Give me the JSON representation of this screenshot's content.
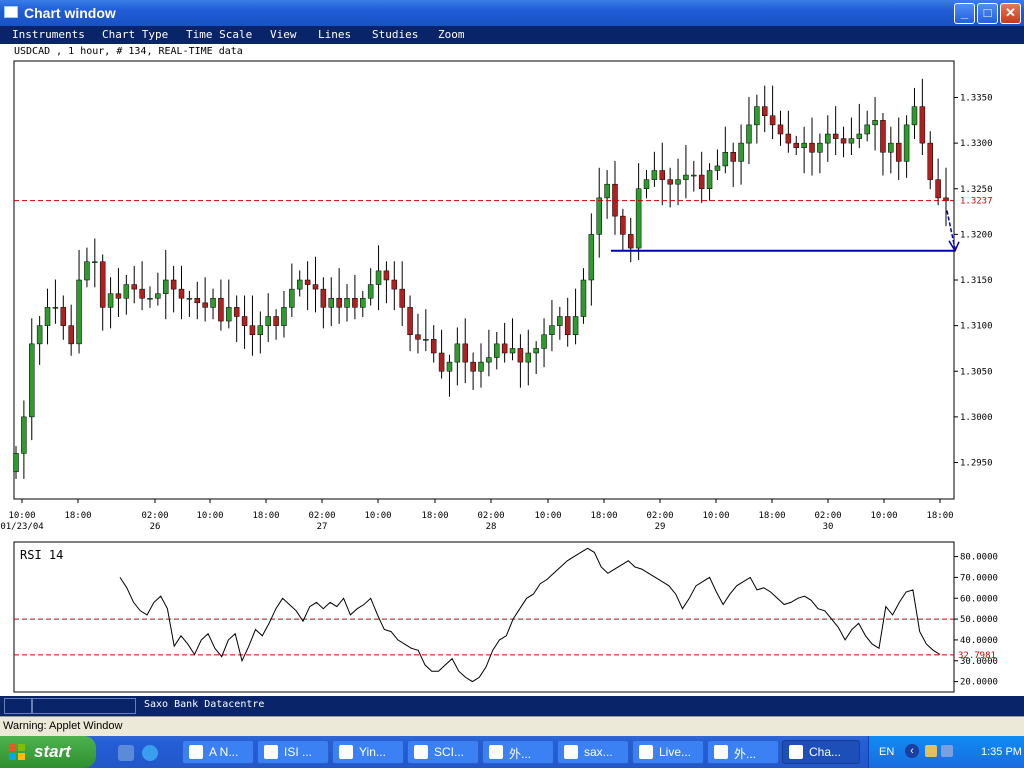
{
  "window": {
    "title": "Chart window"
  },
  "menu": [
    "Instruments",
    "Chart Type",
    "Time Scale",
    "View",
    "Lines",
    "Studies",
    "Zoom"
  ],
  "info": "USDCAD , 1 hour, # 134, REAL-TIME data",
  "chart_data": [
    {
      "type": "candlestick",
      "instrument": "USDCAD",
      "ylim": [
        1.291,
        1.339
      ],
      "yticks": [
        "1.3350",
        "1.3300",
        "1.3250",
        "1.3200",
        "1.3150",
        "1.3100",
        "1.3050",
        "1.3000",
        "1.2950"
      ],
      "price_line_label": "1.3237",
      "price_line_value": 1.3237,
      "support_line_value": 1.3182,
      "xticks": [
        "10:00",
        "18:00",
        "02:00",
        "10:00",
        "18:00",
        "02:00",
        "10:00",
        "18:00",
        "02:00",
        "10:00",
        "18:00",
        "02:00",
        "10:00",
        "18:00",
        "02:00",
        "10:00",
        "18:00"
      ],
      "date_labels": [
        "01/23/04",
        "26",
        "27",
        "28",
        "29",
        "30"
      ],
      "close": [
        1.296,
        1.3,
        1.308,
        1.31,
        1.312,
        1.312,
        1.31,
        1.308,
        1.315,
        1.317,
        1.317,
        1.312,
        1.3135,
        1.313,
        1.3145,
        1.314,
        1.313,
        1.313,
        1.3135,
        1.315,
        1.314,
        1.313,
        1.313,
        1.3125,
        1.312,
        1.313,
        1.3105,
        1.312,
        1.311,
        1.31,
        1.309,
        1.31,
        1.311,
        1.31,
        1.312,
        1.314,
        1.315,
        1.3145,
        1.314,
        1.312,
        1.313,
        1.312,
        1.313,
        1.312,
        1.313,
        1.3145,
        1.316,
        1.315,
        1.314,
        1.312,
        1.309,
        1.3085,
        1.3085,
        1.307,
        1.305,
        1.306,
        1.308,
        1.306,
        1.305,
        1.306,
        1.3065,
        1.308,
        1.307,
        1.3075,
        1.306,
        1.307,
        1.3075,
        1.309,
        1.31,
        1.311,
        1.309,
        1.311,
        1.315,
        1.32,
        1.324,
        1.3255,
        1.322,
        1.32,
        1.3185,
        1.325,
        1.326,
        1.327,
        1.326,
        1.3255,
        1.326,
        1.3265,
        1.3265,
        1.325,
        1.327,
        1.3275,
        1.329,
        1.328,
        1.33,
        1.332,
        1.334,
        1.333,
        1.332,
        1.331,
        1.33,
        1.3295,
        1.33,
        1.329,
        1.33,
        1.331,
        1.3305,
        1.33,
        1.3305,
        1.331,
        1.332,
        1.3325,
        1.329,
        1.33,
        1.328,
        1.332,
        1.334,
        1.33,
        1.326,
        1.324,
        1.3237
      ],
      "annotation": "arrow pointing down to support line"
    },
    {
      "type": "line",
      "title": "RSI 14",
      "ylim": [
        15,
        87
      ],
      "yticks": [
        "80.0000",
        "70.0000",
        "60.0000",
        "50.0000",
        "40.0000",
        "30.0000",
        "20.0000"
      ],
      "level_lines": [
        50,
        32.7981
      ],
      "last_label": "32.7981",
      "values": [
        70,
        65,
        58,
        54,
        52,
        58,
        61,
        55,
        37,
        42,
        38,
        33,
        40,
        43,
        36,
        32,
        40,
        43,
        30,
        37,
        45,
        42,
        48,
        55,
        60,
        57,
        54,
        49,
        56,
        58,
        55,
        58,
        56,
        60,
        52,
        55,
        57,
        60,
        52,
        45,
        44,
        40,
        38,
        36,
        35,
        28,
        25,
        25,
        28,
        31,
        25,
        22,
        20,
        22,
        27,
        35,
        40,
        42,
        50,
        55,
        60,
        62,
        67,
        69,
        72,
        75,
        78,
        80,
        82,
        84,
        82,
        75,
        72,
        74,
        76,
        78,
        75,
        74,
        72,
        70,
        68,
        66,
        62,
        55,
        60,
        66,
        68,
        70,
        63,
        57,
        62,
        66,
        68,
        70,
        64,
        65,
        63,
        60,
        57,
        58,
        60,
        61,
        59,
        55,
        54,
        50,
        46,
        40,
        45,
        48,
        42,
        38,
        36,
        56,
        52,
        58,
        63,
        64,
        44,
        38,
        35,
        33
      ]
    }
  ],
  "status": {
    "source": "Saxo Bank Datacentre"
  },
  "warning": "Warning: Applet Window",
  "taskbar": {
    "start": "start",
    "tasks": [
      "A N...",
      "ISI ...",
      "Yin...",
      "SCI...",
      "外...",
      "sax...",
      "Live...",
      "外...",
      "Cha..."
    ],
    "lang": "EN",
    "clock": "1:35 PM"
  },
  "colors": {
    "bull": "#2e9b2e",
    "bear": "#b02020",
    "level": "#cc0000",
    "support": "#0000b0"
  }
}
